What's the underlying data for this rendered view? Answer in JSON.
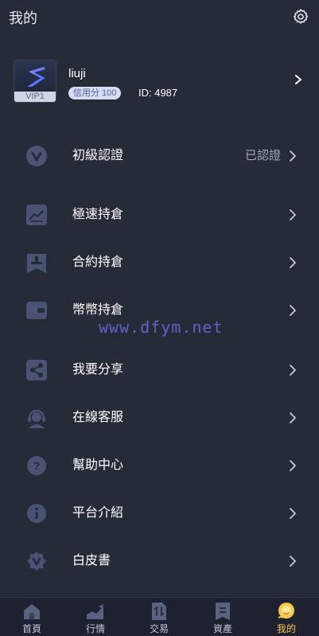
{
  "header": {
    "title": "我的"
  },
  "profile": {
    "avatar_badge": "VIP1",
    "username": "liuji",
    "credit": "信用分 100",
    "user_id": "ID: 4987"
  },
  "menu": [
    {
      "label": "初級認證",
      "value": "已認證",
      "icon": "verified-v-icon"
    },
    {
      "label": "極速持倉",
      "icon": "trend-chart-icon"
    },
    {
      "label": "合約持倉",
      "icon": "stamp-icon"
    },
    {
      "label": "幣幣持倉",
      "icon": "wallet-icon"
    },
    {
      "label": "我要分享",
      "icon": "share-icon"
    },
    {
      "label": "在線客服",
      "icon": "headset-icon"
    },
    {
      "label": "幫助中心",
      "icon": "question-icon"
    },
    {
      "label": "平台介紹",
      "icon": "info-icon"
    },
    {
      "label": "白皮書",
      "icon": "whitepaper-badge-icon"
    }
  ],
  "watermark": "www.dfym.net",
  "nav": [
    {
      "label": "首頁",
      "icon": "home-icon"
    },
    {
      "label": "行情",
      "icon": "market-icon"
    },
    {
      "label": "交易",
      "icon": "trade-icon"
    },
    {
      "label": "資產",
      "icon": "assets-icon"
    },
    {
      "label": "我的",
      "icon": "profile-icon",
      "active": true
    }
  ],
  "colors": {
    "background": "#262b38",
    "icon": "#4a5373",
    "accent": "#f7c948",
    "nav_bg": "#1e2230"
  }
}
